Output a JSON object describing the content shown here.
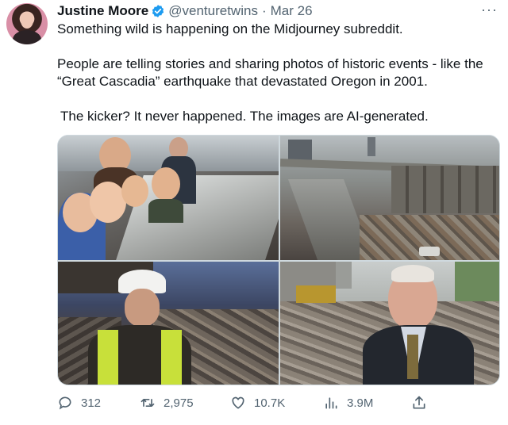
{
  "author": {
    "name": "Justine Moore",
    "handle": "@venturetwins",
    "separator": "·",
    "date": "Mar 26"
  },
  "more_label": "···",
  "tweet": {
    "line1": "Something wild is happening on the Midjourney subreddit.",
    "line2": "People are telling stories and sharing photos of historic events - like the “Great Cascadia” earthquake that devastated Oregon in 2001.",
    "line3": "The kicker? It never happened. The images are AI-generated."
  },
  "metrics": {
    "replies": "312",
    "retweets": "2,975",
    "likes": "10.7K",
    "views": "3.9M"
  },
  "colors": {
    "verified": "#1d9bf0",
    "secondary_text": "#536471",
    "border": "#cfd9de"
  },
  "icons": [
    "verified-icon",
    "more-icon",
    "reply-icon",
    "retweet-icon",
    "like-icon",
    "views-icon",
    "share-icon"
  ]
}
